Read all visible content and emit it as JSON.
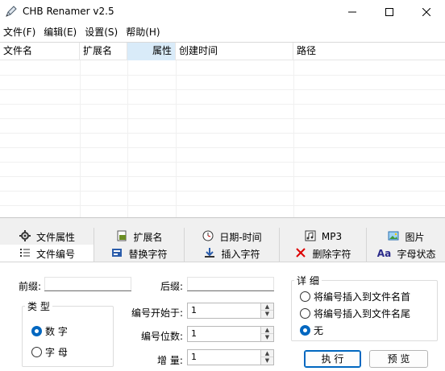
{
  "window": {
    "title": "CHB Renamer v2.5"
  },
  "menu": [
    "文件(F)",
    "编辑(E)",
    "设置(S)",
    "帮助(H)"
  ],
  "list": {
    "columns": [
      "文件名",
      "扩展名",
      "属性",
      "创建时间",
      "路径"
    ],
    "sorted_column": "属性"
  },
  "tabs": {
    "row1": [
      {
        "label": "文件属性",
        "icon": "gear-icon"
      },
      {
        "label": "扩展名",
        "icon": "extension-icon"
      },
      {
        "label": "日期-时间",
        "icon": "clock-icon"
      },
      {
        "label": "MP3",
        "icon": "music-icon"
      },
      {
        "label": "图片",
        "icon": "picture-icon"
      }
    ],
    "row2": [
      {
        "label": "文件编号",
        "icon": "numbered-list-icon",
        "active": true
      },
      {
        "label": "替换字符",
        "icon": "replace-icon"
      },
      {
        "label": "插入字符",
        "icon": "insert-arrow-icon"
      },
      {
        "label": "删除字符",
        "icon": "delete-x-icon"
      },
      {
        "label": "字母状态",
        "icon": "letter-case-icon",
        "glyph": "Aa"
      }
    ]
  },
  "numbering": {
    "prefix_label": "前缀:",
    "prefix_value": "",
    "suffix_label": "后缀:",
    "suffix_value": "",
    "type_group": "类 型",
    "type_options": [
      {
        "label": "数 字",
        "checked": true
      },
      {
        "label": "字 母",
        "checked": false
      }
    ],
    "start_label": "编号开始于:",
    "start_value": "1",
    "digits_label": "编号位数:",
    "digits_value": "1",
    "increment_label": "增 量:",
    "increment_value": "1",
    "detail_group": "详 细",
    "detail_options": [
      {
        "label": "将编号插入到文件名首",
        "checked": false
      },
      {
        "label": "将编号插入到文件名尾",
        "checked": false
      },
      {
        "label": "无",
        "checked": true
      }
    ],
    "execute_label": "执 行",
    "preview_label": "预 览"
  },
  "colors": {
    "accent": "#0067c0",
    "sorted_header": "#d9ebf9",
    "panel_bg": "#f0f0f0"
  }
}
